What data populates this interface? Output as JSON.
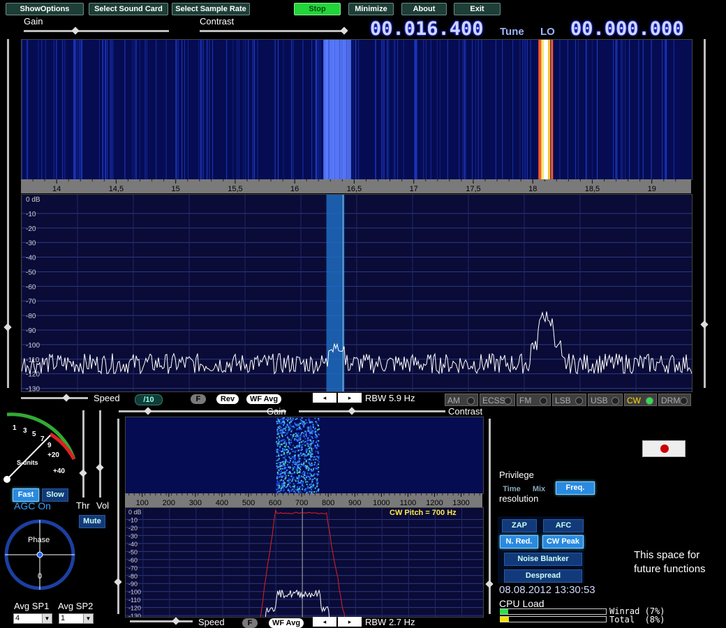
{
  "toolbar": {
    "show_options": "ShowOptions",
    "select_sound_card": "Select Sound Card",
    "select_sample_rate": "Select Sample Rate",
    "stop": "Stop",
    "minimize": "Minimize",
    "about": "About",
    "exit": "Exit"
  },
  "top_sliders": {
    "gain": "Gain",
    "contrast": "Contrast"
  },
  "tuning": {
    "tune_freq": "00.016.400",
    "tune_label": "Tune",
    "lo_label": "LO",
    "lo_freq": "00.000.000"
  },
  "main_scale": {
    "ticks": [
      "14",
      "14,5",
      "15",
      "15,5",
      "16",
      "16,5",
      "17",
      "17,5",
      "18",
      "18,5",
      "19"
    ]
  },
  "main_spectrum": {
    "db_labels": [
      "0 dB",
      "-10",
      "-20",
      "-30",
      "-40",
      "-50",
      "-60",
      "-70",
      "-80",
      "-90",
      "-100",
      "-110",
      "-120",
      "-130"
    ]
  },
  "main_controls": {
    "speed": "Speed",
    "speed_value": "/10",
    "f": "F",
    "rev": "Rev",
    "wf_avg": "WF Avg",
    "rbw": "RBW  5.9 Hz"
  },
  "modes": [
    {
      "label": "AM",
      "active": false
    },
    {
      "label": "ECSS",
      "active": false
    },
    {
      "label": "FM",
      "active": false
    },
    {
      "label": "LSB",
      "active": false
    },
    {
      "label": "USB",
      "active": false
    },
    {
      "label": "CW",
      "active": true
    },
    {
      "label": "DRM",
      "active": false
    }
  ],
  "audio_sliders": {
    "gain": "Gain",
    "contrast": "Contrast"
  },
  "smeter": {
    "label": "S-units",
    "scale": [
      "1",
      "3",
      "5",
      "7",
      "9",
      "+20",
      "+40"
    ]
  },
  "agc": {
    "fast": "Fast",
    "slow": "Slow",
    "status": "AGC On"
  },
  "audio": {
    "thr": "Thr",
    "vol": "Vol",
    "mute": "Mute"
  },
  "phase": {
    "label": "Phase",
    "value": "0"
  },
  "avg": {
    "sp1_label": "Avg SP1",
    "sp2_label": "Avg SP2",
    "sp1_value": "4",
    "sp2_value": "1"
  },
  "audio_scale": {
    "ticks": [
      "100",
      "200",
      "300",
      "400",
      "500",
      "600",
      "700",
      "800",
      "900",
      "1000",
      "1100",
      "1200",
      "1300"
    ]
  },
  "audio_spectrum": {
    "db_labels": [
      "0 dB",
      "-10",
      "-20",
      "-30",
      "-40",
      "-50",
      "-60",
      "-70",
      "-80",
      "-90",
      "-100",
      "-110",
      "-120",
      "-130"
    ],
    "cw_pitch": "CW Pitch = 700 Hz"
  },
  "audio_controls": {
    "speed": "Speed",
    "f": "F",
    "wf_avg": "WF Avg",
    "rbw": "RBW  2.7 Hz"
  },
  "resolution": {
    "privilege": "Privilege",
    "time": "Time",
    "mix": "Mix",
    "freq": "Freq.",
    "resolution": "resolution"
  },
  "dsp": {
    "zap": "ZAP",
    "afc": "AFC",
    "n_red": "N. Red.",
    "cw_peak": "CW Peak",
    "noise_blanker": "Noise Blanker",
    "despread": "Despread"
  },
  "status": {
    "datetime": "08.08.2012 13:30:53",
    "cpu_load": "CPU Load",
    "winrad": "Winrad (7%)",
    "total": "Total  (8%)",
    "winrad_pct": 7,
    "total_pct": 8
  },
  "future": "This space for future functions",
  "colors": {
    "background": "#000000",
    "waterfall": "#050c52",
    "spectrum_bg": "#0a0b36",
    "accent_green": "#21d53a",
    "filter_band": "#1f6cc0"
  }
}
